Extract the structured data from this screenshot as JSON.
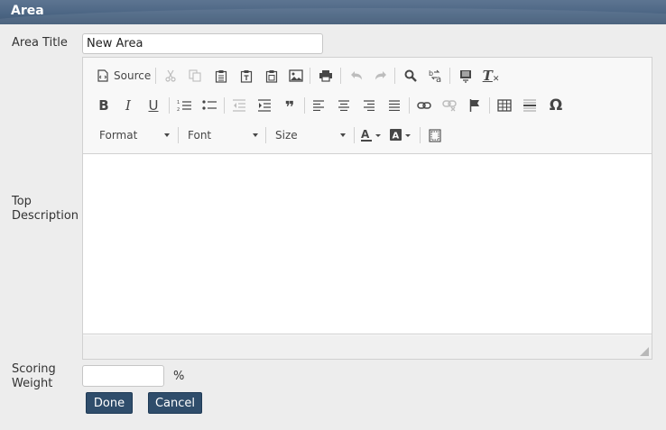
{
  "window": {
    "title": "Area"
  },
  "form": {
    "area_title_label": "Area Title",
    "area_title_value": "New Area",
    "top_description_label_line1": "Top",
    "top_description_label_line2": "Description",
    "scoring_weight_label_line1": "Scoring",
    "scoring_weight_label_line2": "Weight",
    "scoring_weight_value": "",
    "percent_sign": "%"
  },
  "editor": {
    "source_label": "Source",
    "format_label": "Format",
    "font_label": "Font",
    "size_label": "Size",
    "italic_glyph": "I",
    "underline_glyph": "U",
    "clear_format_glyph": "T",
    "quote_glyph": "❞",
    "omega_glyph": "Ω",
    "content": ""
  },
  "buttons": {
    "done_label": "Done",
    "cancel_label": "Cancel"
  },
  "colors": {
    "title_bar": "#4c6684",
    "button_bg": "#2f4d6b",
    "page_bg": "#ededed"
  }
}
